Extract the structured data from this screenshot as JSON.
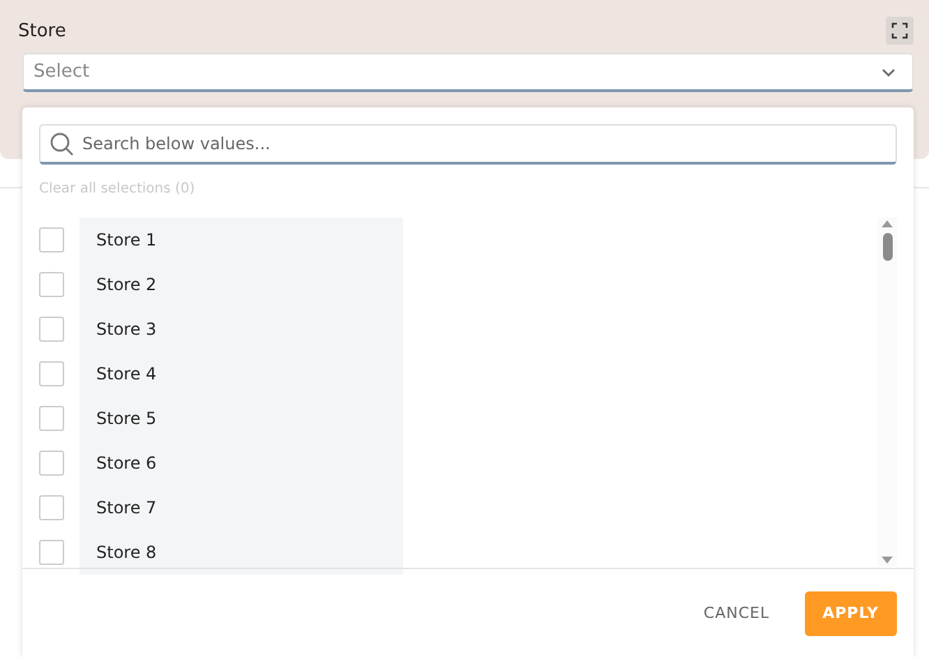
{
  "filter": {
    "label": "Store",
    "select": {
      "placeholder": "Select",
      "expanded": true
    }
  },
  "dropdown": {
    "search": {
      "placeholder": "Search below values..."
    },
    "clear_link": "Clear all selections (0)",
    "items": [
      {
        "label": "Store 1",
        "checked": false
      },
      {
        "label": "Store 2",
        "checked": false
      },
      {
        "label": "Store 3",
        "checked": false
      },
      {
        "label": "Store 4",
        "checked": false
      },
      {
        "label": "Store 5",
        "checked": false
      },
      {
        "label": "Store 6",
        "checked": false
      },
      {
        "label": "Store 7",
        "checked": false
      },
      {
        "label": "Store 8",
        "checked": false
      }
    ],
    "buttons": [
      {
        "label": "CANCEL",
        "kind": "secondary"
      },
      {
        "label": "APPLY",
        "kind": "primary"
      }
    ]
  }
}
